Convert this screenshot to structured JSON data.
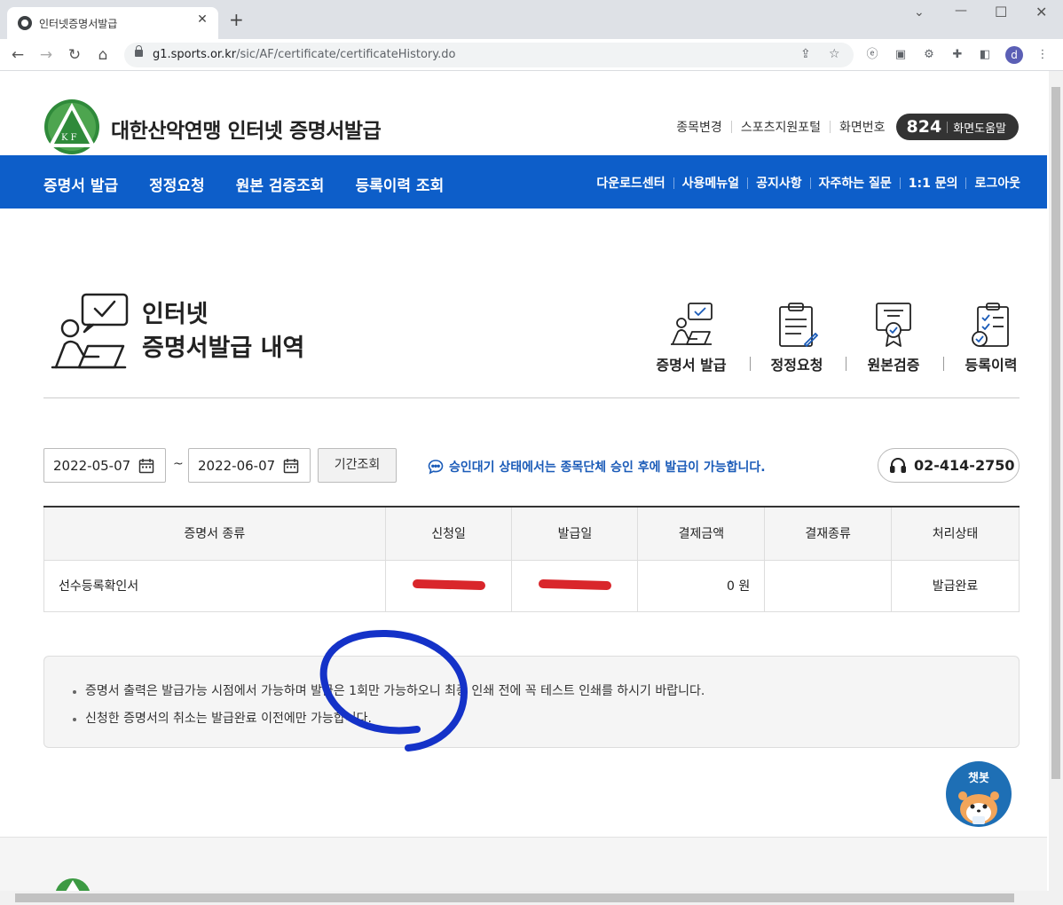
{
  "browser": {
    "tab_title": "인터넷증명서발급",
    "tab_close": "✕",
    "new_tab": "+",
    "url_host": "g1.sports.or.kr",
    "url_path": "/sic/AF/certificate/certificateHistory.do",
    "profile_initial": "d"
  },
  "header": {
    "site_title": "대한산악연맹 인터넷 증명서발급",
    "logo_text": "K F",
    "util_links": [
      "종목변경",
      "스포츠지원포털"
    ],
    "screen_no_label": "화면번호",
    "screen_no": "824",
    "screen_help": "화면도움말"
  },
  "gnb": {
    "main": [
      "증명서 발급",
      "정정요청",
      "원본 검증조회",
      "등록이력 조회"
    ],
    "sub": [
      "다운로드센터",
      "사용메뉴얼",
      "공지사항",
      "자주하는 질문",
      "1:1 문의",
      "로그아웃"
    ]
  },
  "title": {
    "line1": "인터넷",
    "line2": "증명서발급 내역"
  },
  "quick_menu": [
    {
      "label": "증명서 발급",
      "icon": "person-laptop-icon"
    },
    {
      "label": "정정요청",
      "icon": "clipboard-icon"
    },
    {
      "label": "원본검증",
      "icon": "certificate-icon"
    },
    {
      "label": "등록이력",
      "icon": "checklist-icon"
    }
  ],
  "search": {
    "date_from": "2022-05-07",
    "tilde": "~",
    "date_to": "2022-06-07",
    "period_button": "기간조회",
    "notice": "승인대기 상태에서는 종목단체 승인 후에 발급이 가능합니다.",
    "phone": "02-414-2750"
  },
  "table": {
    "headers": [
      "증명서 종류",
      "신청일",
      "발급일",
      "결제금액",
      "결재종류",
      "처리상태"
    ],
    "rows": [
      {
        "type": "선수등록확인서",
        "apply_date": "",
        "issue_date": "",
        "amount": "0 원",
        "pay_type": "",
        "status": "발급완료"
      }
    ]
  },
  "notes": [
    "증명서 출력은 발급가능 시점에서 가능하며 발급은 1회만 가능하오니 최종 인쇄 전에 꼭 테스트 인쇄를 하시기 바랍니다.",
    "신청한 증명서의 취소는 발급완료 이전에만 가능합니다."
  ],
  "chatbot": {
    "label": "챗봇"
  },
  "colors": {
    "brand_blue": "#0d5ec9",
    "notice_blue": "#1a5bb8",
    "annotation_blue": "#1432c8",
    "redaction_red": "#d9262b"
  }
}
